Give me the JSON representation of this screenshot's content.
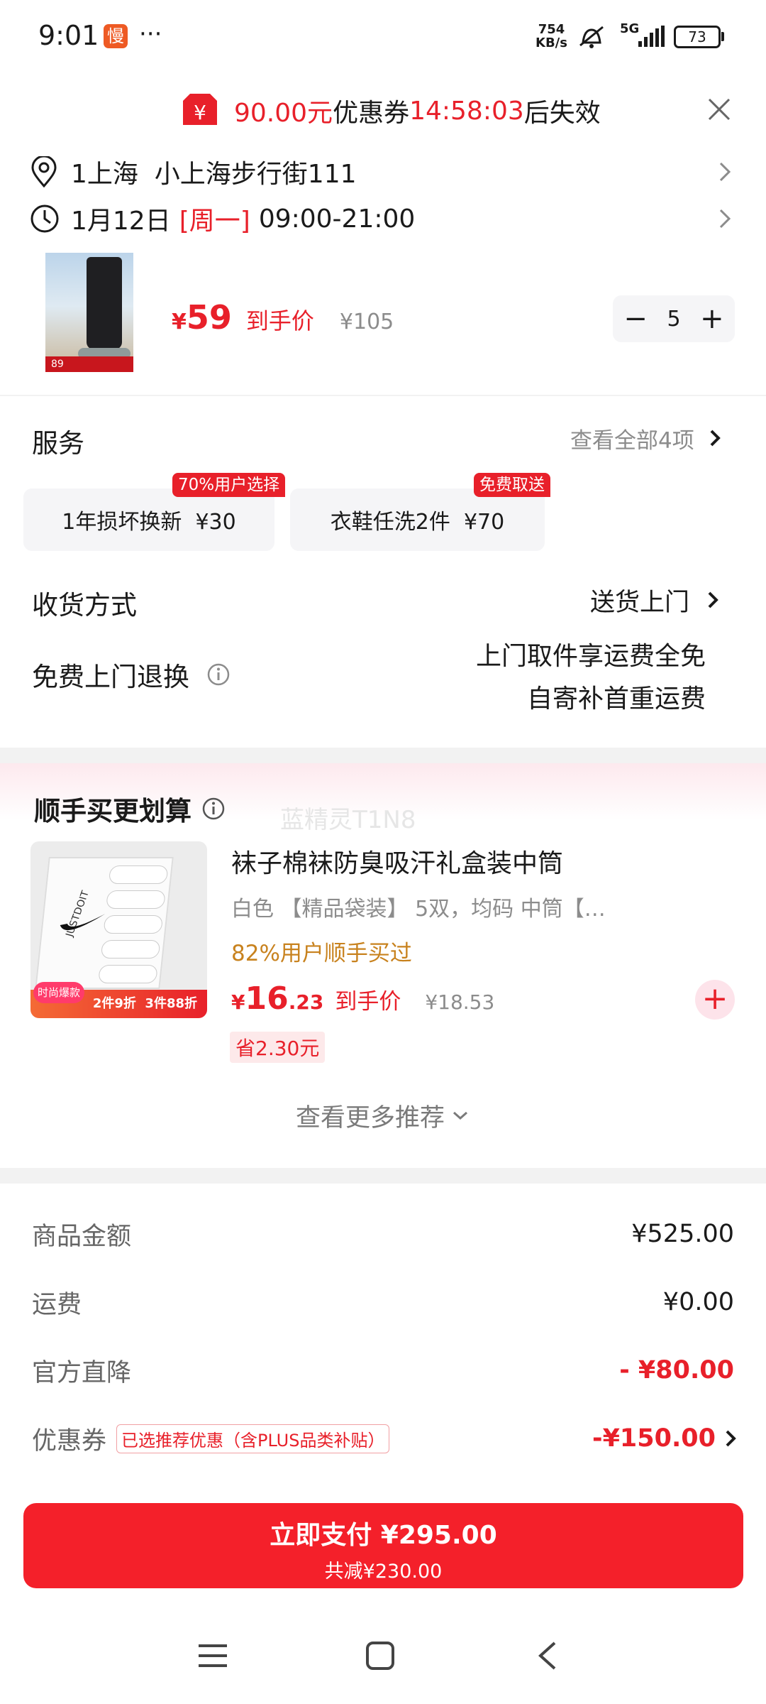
{
  "status_bar": {
    "time": "9:01",
    "app_badge": "慢",
    "dots": "···",
    "speed_top": "754",
    "speed_bottom": "KB/s",
    "network": "5G",
    "battery": "73"
  },
  "coupon_banner": {
    "amount": "90.00元",
    "text_mid": "优惠券",
    "countdown": "14:58:03",
    "text_end": "后失效"
  },
  "address": {
    "line": "1上海  小上海步行街111",
    "date": "1月12日",
    "weekday": "[周一]",
    "hours": "09:00-21:00"
  },
  "product": {
    "currency": "¥",
    "price": "59",
    "price_label": "到手价",
    "original_price": "¥105",
    "quantity": "5",
    "thumb_price": "89"
  },
  "services": {
    "title": "服务",
    "view_all": "查看全部4项",
    "options": [
      {
        "label": "1年损坏换新  ¥30",
        "tag": "70%用户选择"
      },
      {
        "label": "衣鞋任洗2件  ¥70",
        "tag": "免费取送"
      }
    ]
  },
  "delivery": {
    "label": "收货方式",
    "value": "送货上门"
  },
  "returns": {
    "label": "免费上门退换",
    "line1": "上门取件享运费全免",
    "line2": "自寄补首重运费"
  },
  "recommend": {
    "title": "顺手买更划算",
    "watermark": "蓝精灵T1N8",
    "item": {
      "name": "袜子棉袜防臭吸汗礼盒装中筒",
      "spec": "白色 【精品袋装】 5双，均码 中筒【…",
      "social": "82%用户顺手买过",
      "currency": "¥",
      "price_int": "16",
      "price_dec": ".23",
      "price_label": "到手价",
      "original_price": "¥18.53",
      "save": "省2.30元",
      "thumb_brand": "JUSTDOIT",
      "thumb_promo": "2件9折  3件88折",
      "thumb_badge": "时尚爆款"
    },
    "more": "查看更多推荐"
  },
  "summary": {
    "rows": [
      {
        "label": "商品金额",
        "value": "¥525.00"
      },
      {
        "label": "运费",
        "value": "¥0.00"
      },
      {
        "label": "官方直降",
        "value": "- ¥80.00"
      },
      {
        "label": "优惠券",
        "value": "-¥150.00",
        "tag": "已选推荐优惠（含PLUS品类补贴）"
      }
    ]
  },
  "pay_button": {
    "label": "立即支付 ¥295.00",
    "sub": "共减¥230.00"
  },
  "colors": {
    "accent": "#e8202a",
    "orange": "#c8821e"
  }
}
